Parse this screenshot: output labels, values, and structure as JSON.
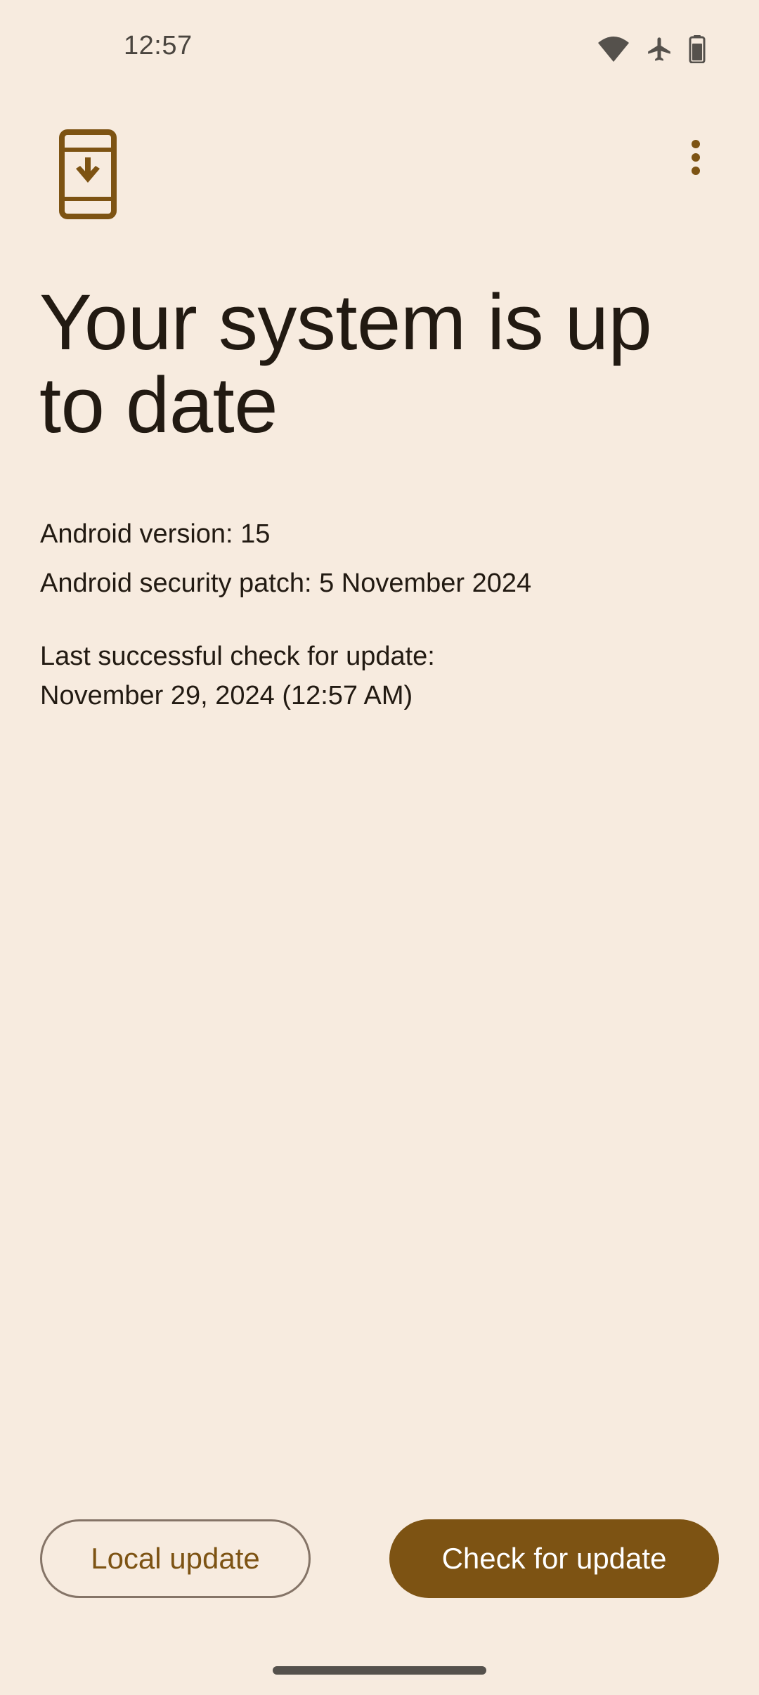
{
  "status_bar": {
    "time": "12:57",
    "icons": [
      "wifi-icon",
      "airplane-mode-icon",
      "battery-icon"
    ]
  },
  "header": {
    "app_icon": "system-update-icon",
    "overflow_icon": "more-vert-icon"
  },
  "main": {
    "title": "Your system is up to date",
    "android_version": "Android version: 15",
    "security_patch": "Android security patch: 5 November 2024",
    "last_check_label": "Last successful check for update:",
    "last_check_value": "November 29, 2024 (12:57 AM)"
  },
  "actions": {
    "local_update_label": "Local update",
    "check_update_label": "Check for update"
  },
  "colors": {
    "background": "#F7EBDF",
    "accent": "#7D5313",
    "text_primary": "#221A12",
    "outline": "#857467"
  }
}
